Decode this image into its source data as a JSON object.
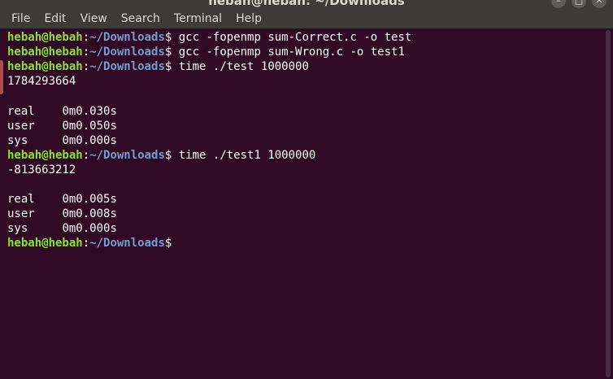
{
  "window": {
    "title": "hebah@hebah: ~/Downloads"
  },
  "menu": [
    "File",
    "Edit",
    "View",
    "Search",
    "Terminal",
    "Help"
  ],
  "prompt": {
    "user": "hebah@hebah",
    "sep": ":",
    "path": "~/Downloads",
    "symbol": "$"
  },
  "lines": [
    {
      "type": "prompt",
      "command": " gcc -fopenmp sum-Correct.c -o test"
    },
    {
      "type": "prompt",
      "command": " gcc -fopenmp sum-Wrong.c -o test1"
    },
    {
      "type": "prompt",
      "command": " time ./test 1000000"
    },
    {
      "type": "output",
      "text": "1784293664"
    },
    {
      "type": "output",
      "text": ""
    },
    {
      "type": "output",
      "text": "real\t0m0.030s"
    },
    {
      "type": "output",
      "text": "user\t0m0.050s"
    },
    {
      "type": "output",
      "text": "sys\t0m0.000s"
    },
    {
      "type": "prompt",
      "command": " time ./test1 1000000"
    },
    {
      "type": "output",
      "text": "-813663212"
    },
    {
      "type": "output",
      "text": ""
    },
    {
      "type": "output",
      "text": "real\t0m0.005s"
    },
    {
      "type": "output",
      "text": "user\t0m0.008s"
    },
    {
      "type": "output",
      "text": "sys\t0m0.000s"
    },
    {
      "type": "prompt",
      "command": ""
    }
  ],
  "colors": {
    "background": "#300a24",
    "prompt_user": "#8ae234",
    "prompt_path": "#729fcf",
    "text": "#ffffff"
  }
}
